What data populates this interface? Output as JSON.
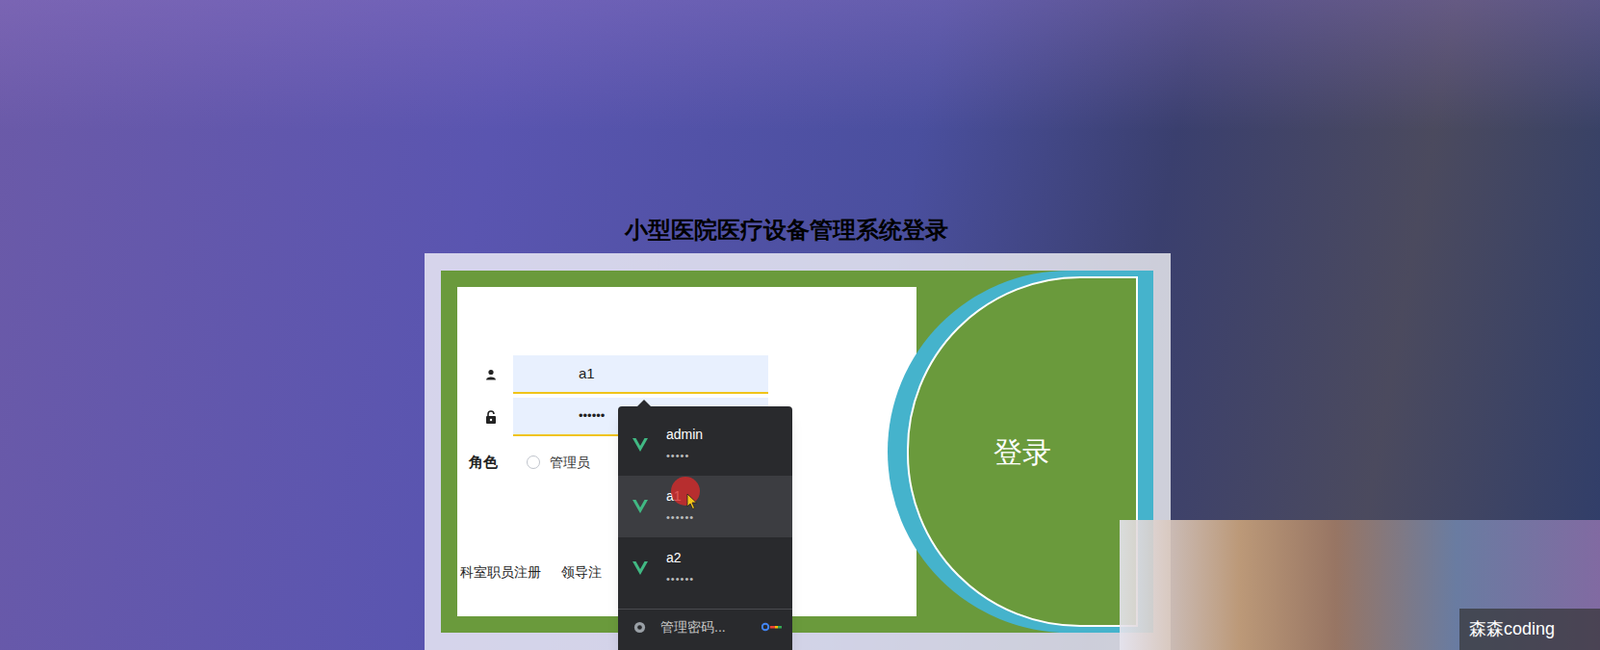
{
  "title": "小型医院医疗设备管理系统登录",
  "login_form": {
    "username": "a1",
    "password": "••••••",
    "role_label": "角色",
    "roles": [
      {
        "label": "管理员",
        "selected": false
      }
    ],
    "submit": "登录",
    "links": [
      "科室职员注册",
      "领导注"
    ]
  },
  "autofill": {
    "items": [
      {
        "username": "admin",
        "password": "•••••",
        "selected": false
      },
      {
        "username": "a1",
        "password": "••••••",
        "selected": true
      },
      {
        "username": "a2",
        "password": "••••••",
        "selected": false
      }
    ],
    "manage": "管理密码..."
  },
  "watermark": "森森coding"
}
